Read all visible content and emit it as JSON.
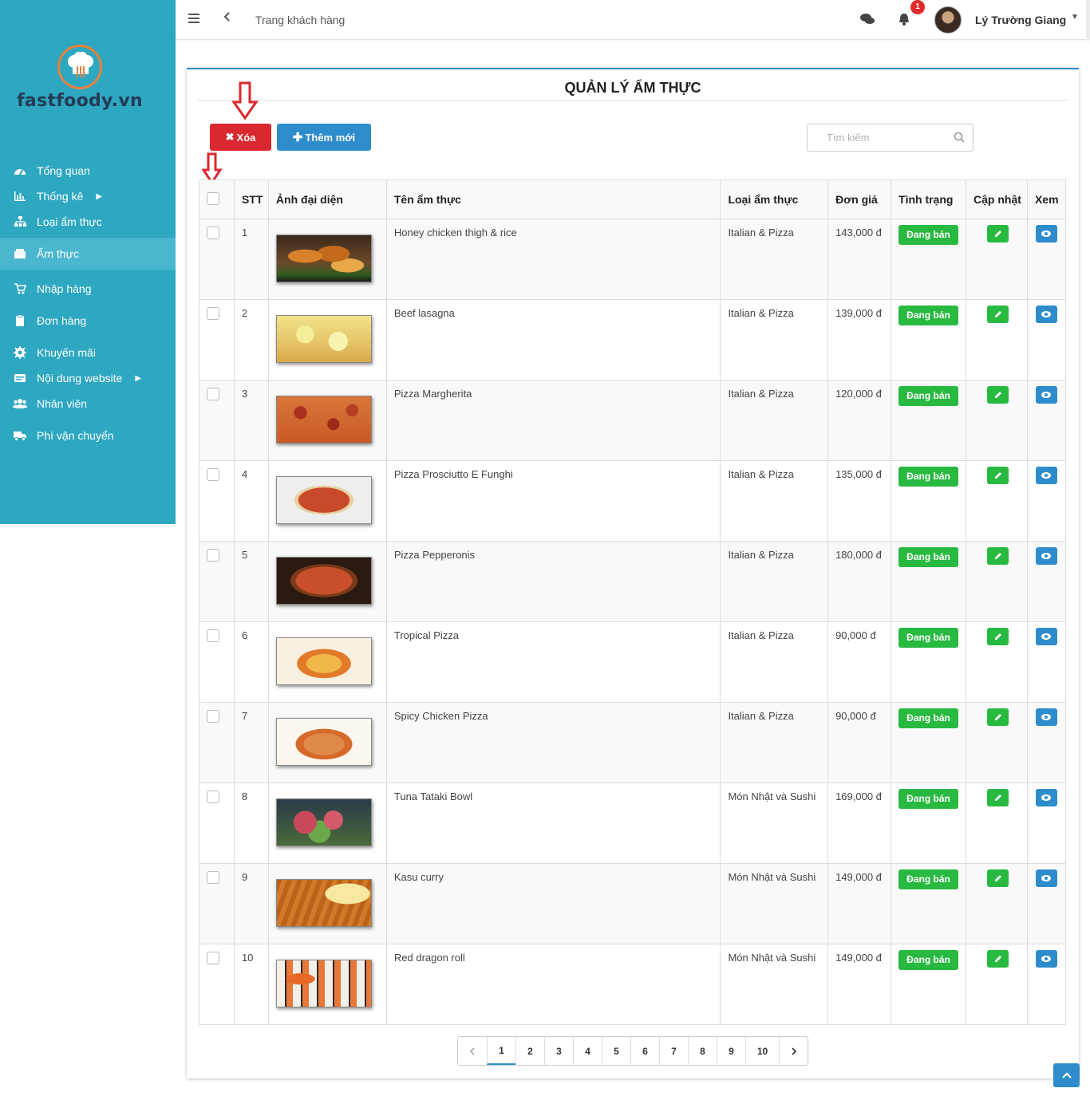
{
  "brand": {
    "name": "fastfoody.vn"
  },
  "sidebar": {
    "items": [
      {
        "label": "Tổng quan",
        "icon": "dashboard-icon"
      },
      {
        "label": "Thống kê",
        "icon": "chart-icon",
        "has_submenu": true
      },
      {
        "label": "Loại ẩm thực",
        "icon": "sitemap-icon"
      },
      {
        "label": "Ẩm thực",
        "icon": "food-icon",
        "active": true
      },
      {
        "label": "Nhập hàng",
        "icon": "cart-icon"
      },
      {
        "label": "Đơn hàng",
        "icon": "clipboard-icon"
      },
      {
        "label": "Khuyến mãi",
        "icon": "promo-icon"
      },
      {
        "label": "Nội dung website",
        "icon": "content-icon",
        "has_submenu": true
      },
      {
        "label": "Nhân viên",
        "icon": "users-icon"
      },
      {
        "label": "Phí vận chuyển",
        "icon": "truck-icon"
      }
    ]
  },
  "topbar": {
    "title": "Trang khách hàng",
    "notification_count": "1",
    "user_name": "Lý Trường Giang"
  },
  "page": {
    "title": "QUẢN LÝ ẨM THỰC",
    "delete_label": "Xóa",
    "add_label": "Thêm mới",
    "search_placeholder": "Tìm kiếm"
  },
  "table": {
    "headers": [
      "STT",
      "Ảnh đại diện",
      "Tên ẩm thực",
      "Loại ẩm thực",
      "Đơn giá",
      "Tình trạng",
      "Cập nhật",
      "Xem"
    ],
    "rows": [
      {
        "stt": "1",
        "name": "Honey chicken thigh & rice",
        "category": "Italian & Pizza",
        "price": "143,000 đ",
        "status": "Đang bán",
        "image": "chicken"
      },
      {
        "stt": "2",
        "name": "Beef lasagna",
        "category": "Italian & Pizza",
        "price": "139,000 đ",
        "status": "Đang bán",
        "image": "lasagna"
      },
      {
        "stt": "3",
        "name": "Pizza Margherita",
        "category": "Italian & Pizza",
        "price": "120,000 đ",
        "status": "Đang bán",
        "image": "margherita"
      },
      {
        "stt": "4",
        "name": "Pizza Prosciutto E Funghi",
        "category": "Italian & Pizza",
        "price": "135,000 đ",
        "status": "Đang bán",
        "image": "funghi"
      },
      {
        "stt": "5",
        "name": "Pizza Pepperonis",
        "category": "Italian & Pizza",
        "price": "180,000 đ",
        "status": "Đang bán",
        "image": "pepperoni"
      },
      {
        "stt": "6",
        "name": "Tropical Pizza",
        "category": "Italian & Pizza",
        "price": "90,000 đ",
        "status": "Đang bán",
        "image": "tropical"
      },
      {
        "stt": "7",
        "name": "Spicy Chicken Pizza",
        "category": "Italian & Pizza",
        "price": "90,000 đ",
        "status": "Đang bán",
        "image": "spicy"
      },
      {
        "stt": "8",
        "name": "Tuna Tataki Bowl",
        "category": "Món Nhật và Sushi",
        "price": "169,000 đ",
        "status": "Đang bán",
        "image": "tuna"
      },
      {
        "stt": "9",
        "name": "Kasu curry",
        "category": "Món Nhật và Sushi",
        "price": "149,000 đ",
        "status": "Đang bán",
        "image": "curry"
      },
      {
        "stt": "10",
        "name": "Red dragon roll",
        "category": "Món Nhật và Sushi",
        "price": "149,000 đ",
        "status": "Đang bán",
        "image": "sushi"
      }
    ]
  },
  "pagination": {
    "pages": [
      "1",
      "2",
      "3",
      "4",
      "5",
      "6",
      "7",
      "8",
      "9",
      "10"
    ],
    "current": "1"
  },
  "colors": {
    "sidebar": "#2ea7c1",
    "primary": "#2e8ccc",
    "danger": "#d9282f",
    "success": "#28b940"
  }
}
